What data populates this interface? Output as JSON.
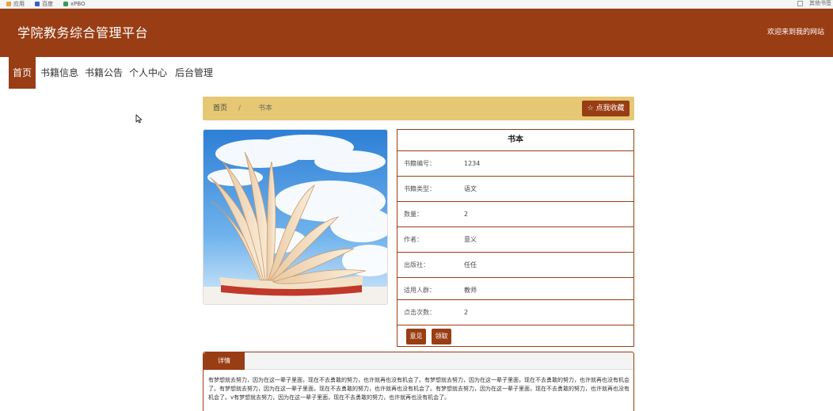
{
  "browser": {
    "bookmarks": [
      {
        "label": "应用",
        "color": "#e8a33d"
      },
      {
        "label": "百度",
        "color": "#3b5ec9"
      },
      {
        "label": "xPBO",
        "color": "#3a9a57"
      }
    ],
    "right_label": "其他书签"
  },
  "header": {
    "site_title": "学院教务综合管理平台",
    "welcome": "欢迎来到我的网站",
    "bg_color": "#993d14"
  },
  "nav": {
    "items": [
      {
        "label": "首页",
        "active": true
      },
      {
        "label": "书籍信息",
        "active": false
      },
      {
        "label": "书籍公告",
        "active": false
      },
      {
        "label": "个人中心",
        "active": false
      },
      {
        "label": "后台管理",
        "active": false
      }
    ]
  },
  "breadcrumb": {
    "home": "首页",
    "separator": "/",
    "current": "书本",
    "favorite_button": "☆ 点我收藏",
    "bar_color": "#e6c874"
  },
  "book": {
    "title": "书本",
    "cover_icon": "open-book-sky-image",
    "fields": [
      {
        "label": "书籍编号：",
        "value": "1234"
      },
      {
        "label": "书籍类型：",
        "value": "语文"
      },
      {
        "label": "数量：",
        "value": "2"
      },
      {
        "label": "作者：",
        "value": "意义"
      },
      {
        "label": "出版社：",
        "value": "任任"
      },
      {
        "label": "适用人群：",
        "value": "教师"
      },
      {
        "label": "点击次数：",
        "value": "2"
      }
    ],
    "actions": [
      {
        "label": "意见"
      },
      {
        "label": "领取"
      }
    ]
  },
  "detail": {
    "tab_label": "详情",
    "text": "有梦想就去努力，因为在这一辈子里面，现在不去勇敢的努力，也许就再也没有机会了。有梦想就去努力，因为在这一辈子里面，现在不去勇敢的努力，也许就再也没有机会了。有梦想就去努力，因为在这一辈子里面，现在不去勇敢的努力，也许就再也没有机会了。有梦想就去努力，因为在这一辈子里面，现在不去勇敢的努力，也许就再也没有机会了。v有梦想就去努力，因为在这一辈子里面，现在不去勇敢的努力，也许就再也没有机会了。"
  }
}
